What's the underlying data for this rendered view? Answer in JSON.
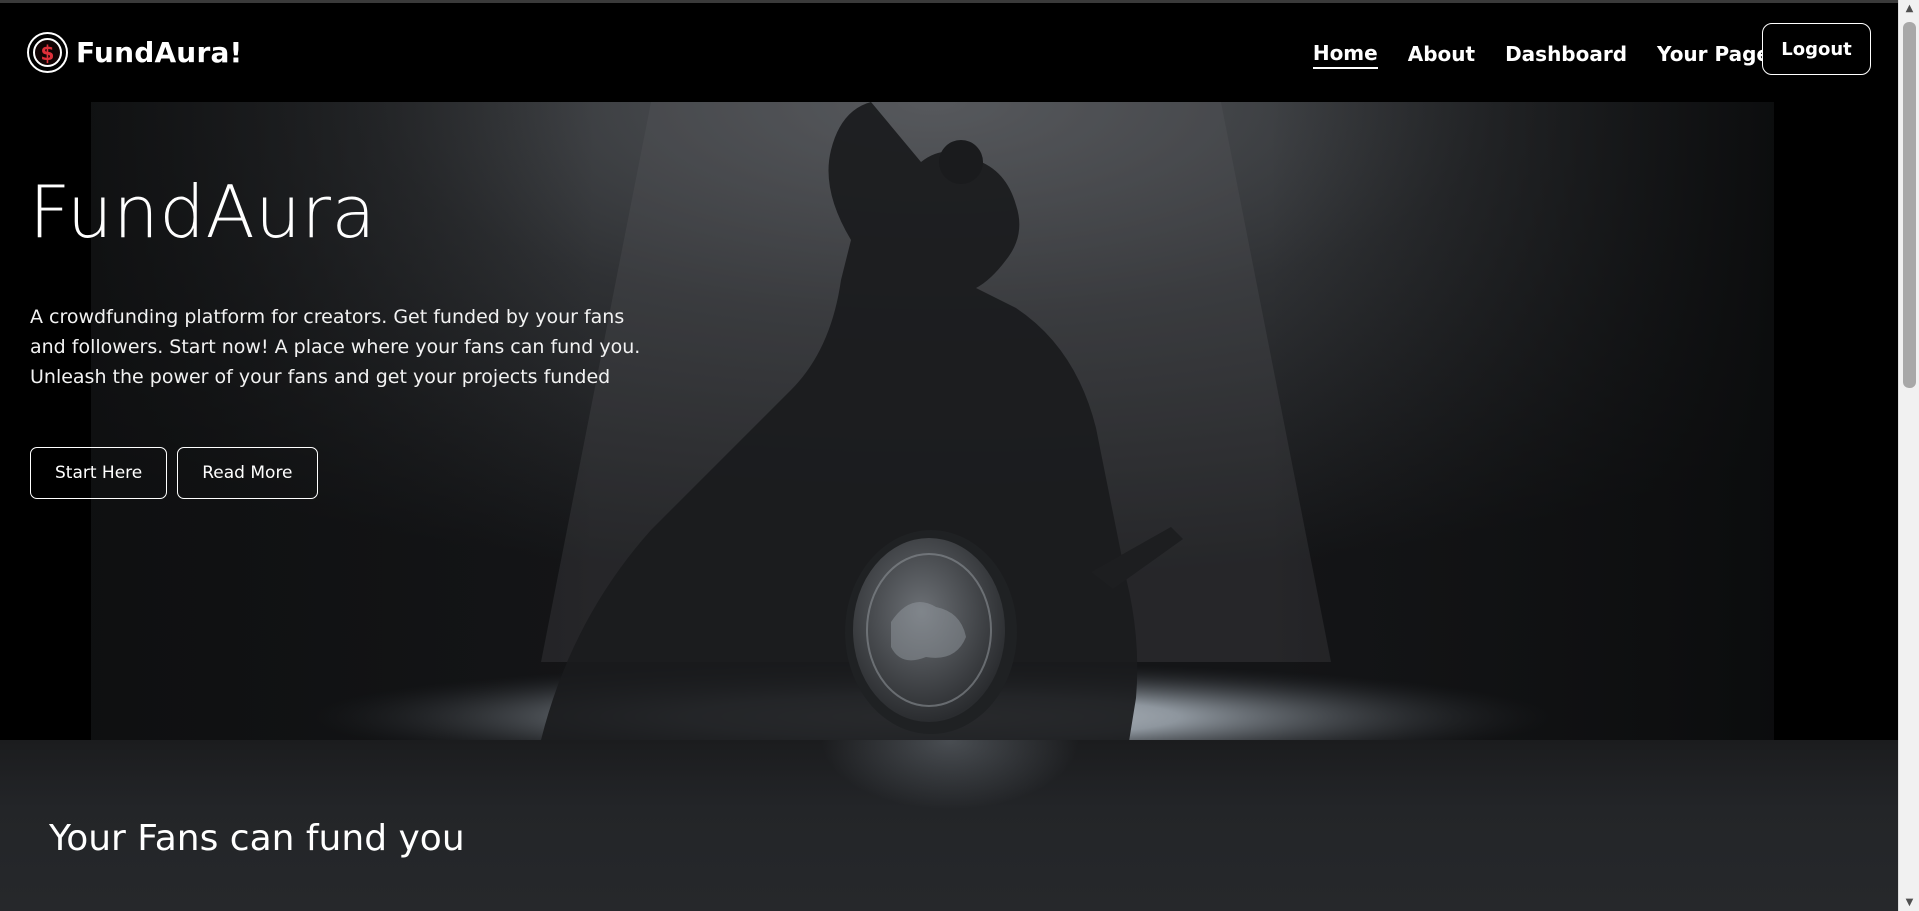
{
  "brand": {
    "name": "FundAura!",
    "logo_symbol": "$",
    "logo_color": "#e0303a"
  },
  "nav": {
    "links": [
      {
        "label": "Home",
        "active": true
      },
      {
        "label": "About",
        "active": false
      },
      {
        "label": "Dashboard",
        "active": false
      },
      {
        "label": "Your Page",
        "active": false
      }
    ],
    "logout_label": "Logout"
  },
  "hero": {
    "title": "FundAura",
    "description": "A crowdfunding platform for creators. Get funded by your fans and followers. Start now! A place where your fans can fund you. Unleash the power of your fans and get your projects funded",
    "buttons": {
      "start": "Start Here",
      "read_more": "Read More"
    }
  },
  "section": {
    "title": "Your Fans can fund you"
  },
  "icons": {
    "logo": "dollar-coin-icon",
    "scroll_up": "chevron-up-icon",
    "scroll_down": "chevron-down-icon"
  }
}
